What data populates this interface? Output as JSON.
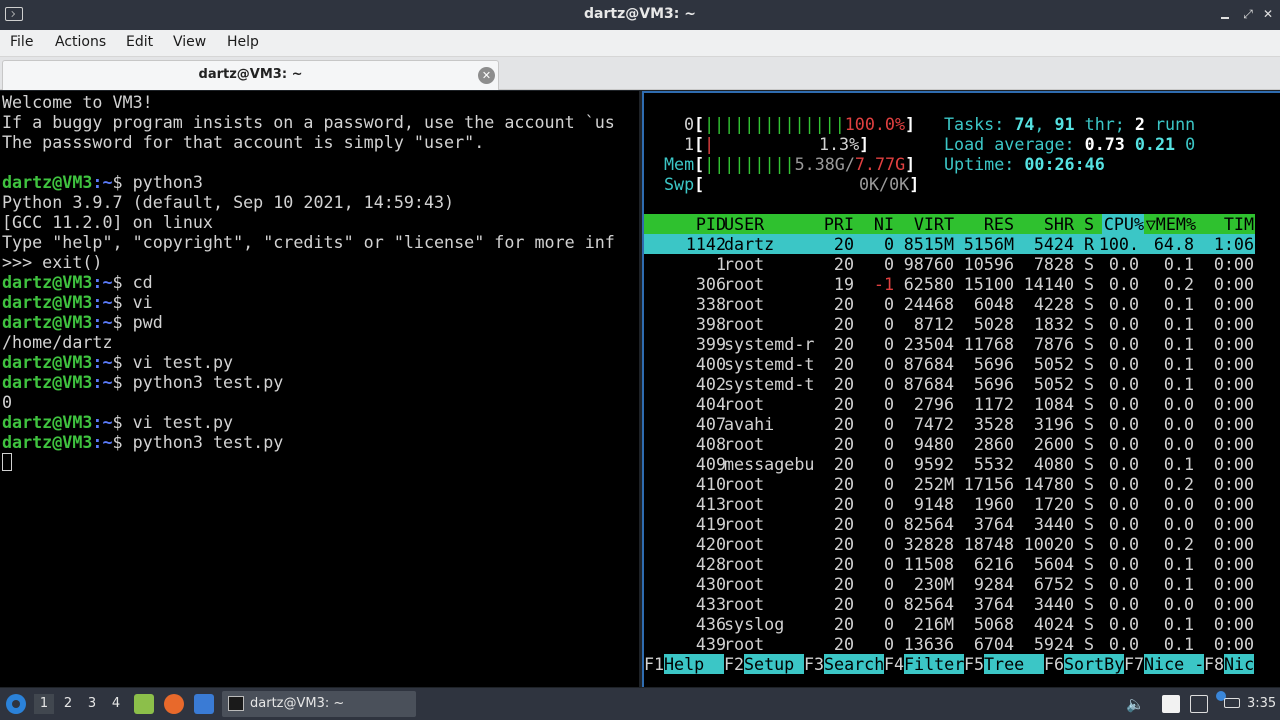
{
  "window": {
    "title": "dartz@VM3: ~"
  },
  "menu": [
    "File",
    "Actions",
    "Edit",
    "View",
    "Help"
  ],
  "tab": {
    "label": "dartz@VM3: ~"
  },
  "terminal_left": {
    "lines": [
      {
        "t": "plain",
        "text": "Welcome to VM3!"
      },
      {
        "t": "plain",
        "text": "If a buggy program insists on a password, use the account `us"
      },
      {
        "t": "plain",
        "text": "The passsword for that account is simply \"user\"."
      },
      {
        "t": "plain",
        "text": ""
      },
      {
        "t": "prompt",
        "user": "dartz@VM3",
        "path": ":~",
        "cmd": "$ python3"
      },
      {
        "t": "plain",
        "text": "Python 3.9.7 (default, Sep 10 2021, 14:59:43)"
      },
      {
        "t": "plain",
        "text": "[GCC 11.2.0] on linux"
      },
      {
        "t": "plain",
        "text": "Type \"help\", \"copyright\", \"credits\" or \"license\" for more inf"
      },
      {
        "t": "plain",
        "text": ">>> exit()"
      },
      {
        "t": "prompt",
        "user": "dartz@VM3",
        "path": ":~",
        "cmd": "$ cd"
      },
      {
        "t": "prompt",
        "user": "dartz@VM3",
        "path": ":~",
        "cmd": "$ vi"
      },
      {
        "t": "prompt",
        "user": "dartz@VM3",
        "path": ":~",
        "cmd": "$ pwd"
      },
      {
        "t": "plain",
        "text": "/home/dartz"
      },
      {
        "t": "prompt",
        "user": "dartz@VM3",
        "path": ":~",
        "cmd": "$ vi test.py"
      },
      {
        "t": "prompt",
        "user": "dartz@VM3",
        "path": ":~",
        "cmd": "$ python3 test.py"
      },
      {
        "t": "plain",
        "text": "0"
      },
      {
        "t": "prompt",
        "user": "dartz@VM3",
        "path": ":~",
        "cmd": "$ vi test.py"
      },
      {
        "t": "prompt",
        "user": "dartz@VM3",
        "path": ":~",
        "cmd": "$ python3 test.py"
      },
      {
        "t": "cursor"
      }
    ]
  },
  "htop": {
    "cpu0": {
      "label": "0",
      "bars": "||||||||||||||",
      "value": "100.0%"
    },
    "cpu1": {
      "label": "1",
      "bars": "|",
      "value": "1.3%"
    },
    "mem": {
      "label": "Mem",
      "bars": "|||||||||",
      "used": "5.38G",
      "sep": "/",
      "total": "7.77G"
    },
    "swp": {
      "label": "Swp",
      "value": "0K/0K"
    },
    "tasks": {
      "label": "Tasks: ",
      "count": "74",
      "sep1": ", ",
      "threads": "91",
      "thr_label": " thr; ",
      "running": "2",
      "run_label": " runn"
    },
    "load": {
      "label": "Load average: ",
      "l1": "0.73",
      "l5": "0.21",
      "l15": "0"
    },
    "uptime": {
      "label": "Uptime: ",
      "value": "00:26:46"
    },
    "columns": [
      "PID",
      "USER",
      "PRI",
      "NI",
      "VIRT",
      "RES",
      "SHR",
      "S",
      "CPU%",
      "▽MEM%",
      "TIM"
    ],
    "processes": [
      {
        "pid": "1142",
        "user": "dartz",
        "pri": "20",
        "ni": "0",
        "virt": "8515M",
        "res": "5156M",
        "shr": "5424",
        "s": "R",
        "cpu": "100.",
        "mem": "64.8",
        "time": "1:06",
        "selected": true
      },
      {
        "pid": "1",
        "user": "root",
        "pri": "20",
        "ni": "0",
        "virt": "98760",
        "res": "10596",
        "shr": "7828",
        "s": "S",
        "cpu": "0.0",
        "mem": "0.1",
        "time": "0:00"
      },
      {
        "pid": "306",
        "user": "root",
        "pri": "19",
        "ni": "-1",
        "virt": "62580",
        "res": "15100",
        "shr": "14140",
        "s": "S",
        "cpu": "0.0",
        "mem": "0.2",
        "time": "0:00"
      },
      {
        "pid": "338",
        "user": "root",
        "pri": "20",
        "ni": "0",
        "virt": "24468",
        "res": "6048",
        "shr": "4228",
        "s": "S",
        "cpu": "0.0",
        "mem": "0.1",
        "time": "0:00"
      },
      {
        "pid": "398",
        "user": "root",
        "pri": "20",
        "ni": "0",
        "virt": "8712",
        "res": "5028",
        "shr": "1832",
        "s": "S",
        "cpu": "0.0",
        "mem": "0.1",
        "time": "0:00"
      },
      {
        "pid": "399",
        "user": "systemd-r",
        "pri": "20",
        "ni": "0",
        "virt": "23504",
        "res": "11768",
        "shr": "7876",
        "s": "S",
        "cpu": "0.0",
        "mem": "0.1",
        "time": "0:00"
      },
      {
        "pid": "400",
        "user": "systemd-t",
        "pri": "20",
        "ni": "0",
        "virt": "87684",
        "res": "5696",
        "shr": "5052",
        "s": "S",
        "cpu": "0.0",
        "mem": "0.1",
        "time": "0:00"
      },
      {
        "pid": "402",
        "user": "systemd-t",
        "pri": "20",
        "ni": "0",
        "virt": "87684",
        "res": "5696",
        "shr": "5052",
        "s": "S",
        "cpu": "0.0",
        "mem": "0.1",
        "time": "0:00"
      },
      {
        "pid": "404",
        "user": "root",
        "pri": "20",
        "ni": "0",
        "virt": "2796",
        "res": "1172",
        "shr": "1084",
        "s": "S",
        "cpu": "0.0",
        "mem": "0.0",
        "time": "0:00"
      },
      {
        "pid": "407",
        "user": "avahi",
        "pri": "20",
        "ni": "0",
        "virt": "7472",
        "res": "3528",
        "shr": "3196",
        "s": "S",
        "cpu": "0.0",
        "mem": "0.0",
        "time": "0:00"
      },
      {
        "pid": "408",
        "user": "root",
        "pri": "20",
        "ni": "0",
        "virt": "9480",
        "res": "2860",
        "shr": "2600",
        "s": "S",
        "cpu": "0.0",
        "mem": "0.0",
        "time": "0:00"
      },
      {
        "pid": "409",
        "user": "messagebu",
        "pri": "20",
        "ni": "0",
        "virt": "9592",
        "res": "5532",
        "shr": "4080",
        "s": "S",
        "cpu": "0.0",
        "mem": "0.1",
        "time": "0:00"
      },
      {
        "pid": "410",
        "user": "root",
        "pri": "20",
        "ni": "0",
        "virt": "252M",
        "res": "17156",
        "shr": "14780",
        "s": "S",
        "cpu": "0.0",
        "mem": "0.2",
        "time": "0:00"
      },
      {
        "pid": "413",
        "user": "root",
        "pri": "20",
        "ni": "0",
        "virt": "9148",
        "res": "1960",
        "shr": "1720",
        "s": "S",
        "cpu": "0.0",
        "mem": "0.0",
        "time": "0:00"
      },
      {
        "pid": "419",
        "user": "root",
        "pri": "20",
        "ni": "0",
        "virt": "82564",
        "res": "3764",
        "shr": "3440",
        "s": "S",
        "cpu": "0.0",
        "mem": "0.0",
        "time": "0:00"
      },
      {
        "pid": "420",
        "user": "root",
        "pri": "20",
        "ni": "0",
        "virt": "32828",
        "res": "18748",
        "shr": "10020",
        "s": "S",
        "cpu": "0.0",
        "mem": "0.2",
        "time": "0:00"
      },
      {
        "pid": "428",
        "user": "root",
        "pri": "20",
        "ni": "0",
        "virt": "11508",
        "res": "6216",
        "shr": "5604",
        "s": "S",
        "cpu": "0.0",
        "mem": "0.1",
        "time": "0:00"
      },
      {
        "pid": "430",
        "user": "root",
        "pri": "20",
        "ni": "0",
        "virt": "230M",
        "res": "9284",
        "shr": "6752",
        "s": "S",
        "cpu": "0.0",
        "mem": "0.1",
        "time": "0:00"
      },
      {
        "pid": "433",
        "user": "root",
        "pri": "20",
        "ni": "0",
        "virt": "82564",
        "res": "3764",
        "shr": "3440",
        "s": "S",
        "cpu": "0.0",
        "mem": "0.0",
        "time": "0:00"
      },
      {
        "pid": "436",
        "user": "syslog",
        "pri": "20",
        "ni": "0",
        "virt": "216M",
        "res": "5068",
        "shr": "4024",
        "s": "S",
        "cpu": "0.0",
        "mem": "0.1",
        "time": "0:00"
      },
      {
        "pid": "439",
        "user": "root",
        "pri": "20",
        "ni": "0",
        "virt": "13636",
        "res": "6704",
        "shr": "5924",
        "s": "S",
        "cpu": "0.0",
        "mem": "0.1",
        "time": "0:00"
      }
    ],
    "fkeys": [
      {
        "key": "F1",
        "label": "Help  "
      },
      {
        "key": "F2",
        "label": "Setup "
      },
      {
        "key": "F3",
        "label": "Search"
      },
      {
        "key": "F4",
        "label": "Filter"
      },
      {
        "key": "F5",
        "label": "Tree  "
      },
      {
        "key": "F6",
        "label": "SortBy"
      },
      {
        "key": "F7",
        "label": "Nice -"
      },
      {
        "key": "F8",
        "label": "Nic"
      }
    ]
  },
  "taskbar": {
    "workspaces": [
      "1",
      "2",
      "3",
      "4"
    ],
    "task_label": "dartz@VM3: ~",
    "clock": "3:35",
    "icons": [
      "start-menu-icon",
      "file-manager-icon",
      "firefox-icon",
      "show-desktop-icon"
    ],
    "tray_icons": [
      "volume-icon",
      "clipboard-icon",
      "update-notifier-icon",
      "battery-icon",
      "network-icon"
    ]
  },
  "colors": {
    "prompt_user": "#3fc33f",
    "prompt_path": "#5c7cfa",
    "htop_header": "#2fc12f",
    "htop_selected": "#3bc6c6",
    "pane_border": "#2f6cb0"
  }
}
